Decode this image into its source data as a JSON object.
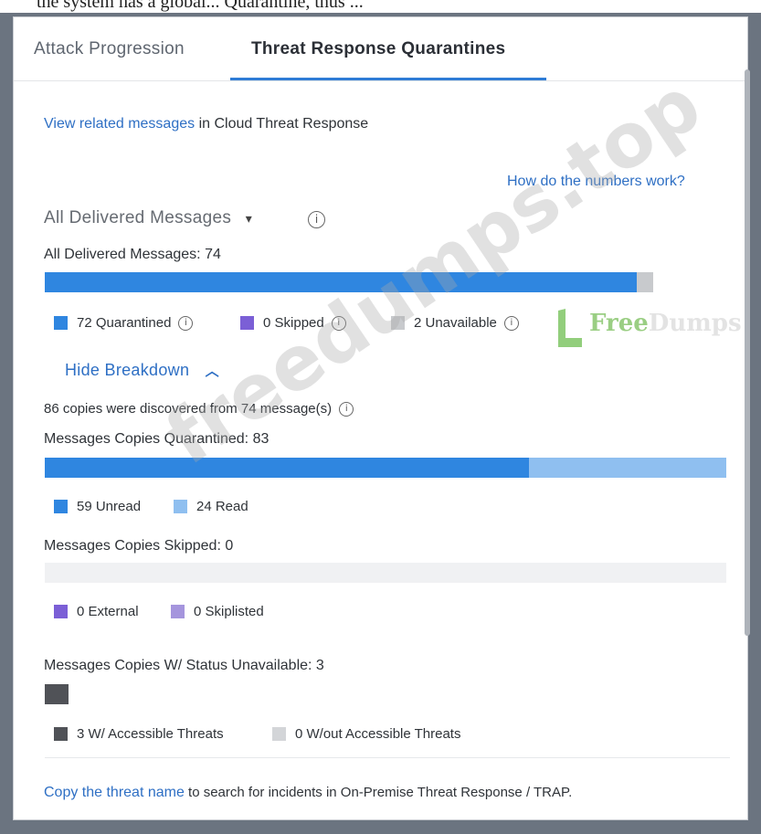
{
  "caption": "the system has a global... Quarantine, thus ...",
  "tabs": [
    {
      "label": "Attack Progression",
      "active": false
    },
    {
      "label": "Threat Response Quarantines",
      "active": true
    }
  ],
  "view_related": {
    "link": "View related messages",
    "suffix": " in Cloud Threat Response"
  },
  "numbers_link": "How do the numbers work?",
  "filter": {
    "label": "All Delivered Messages",
    "caret": "▾"
  },
  "delivered": {
    "heading": "All Delivered Messages: 74",
    "total": 74,
    "legend": [
      {
        "label": "72 Quarantined",
        "value": 72,
        "color": "#2f86e0"
      },
      {
        "label": "0 Skipped",
        "value": 0,
        "color": "#7b5fd6"
      },
      {
        "label": "2 Unavailable",
        "value": 2,
        "color": "#c8cacd"
      }
    ]
  },
  "breakdown_toggle": "Hide Breakdown",
  "copies_note": "86 copies were discovered from 74 message(s)",
  "quarantined": {
    "heading": "Messages Copies Quarantined: 83",
    "total": 83,
    "legend": [
      {
        "label": "59 Unread",
        "value": 59,
        "color": "#2f86e0"
      },
      {
        "label": "24 Read",
        "value": 24,
        "color": "#8fbff0"
      }
    ]
  },
  "skipped": {
    "heading": "Messages Copies Skipped: 0",
    "total": 0,
    "legend": [
      {
        "label": "0 External",
        "value": 0,
        "color": "#7b5fd6"
      },
      {
        "label": "0 Skiplisted",
        "value": 0,
        "color": "#a595dd"
      }
    ]
  },
  "unavailable": {
    "heading": "Messages Copies W/ Status Unavailable: 3",
    "total": 3,
    "legend": [
      {
        "label": "3 W/ Accessible Threats",
        "value": 3,
        "color": "#505257"
      },
      {
        "label": "0 W/out Accessible Threats",
        "value": 0,
        "color": "#d3d5d8"
      }
    ]
  },
  "footer": {
    "link": "Copy the threat name",
    "suffix": " to search for incidents in On-Premise Threat Response / TRAP."
  },
  "watermark": {
    "diagonal": "freedumps.top",
    "brand_a": "Free",
    "brand_b": "Dumps"
  }
}
